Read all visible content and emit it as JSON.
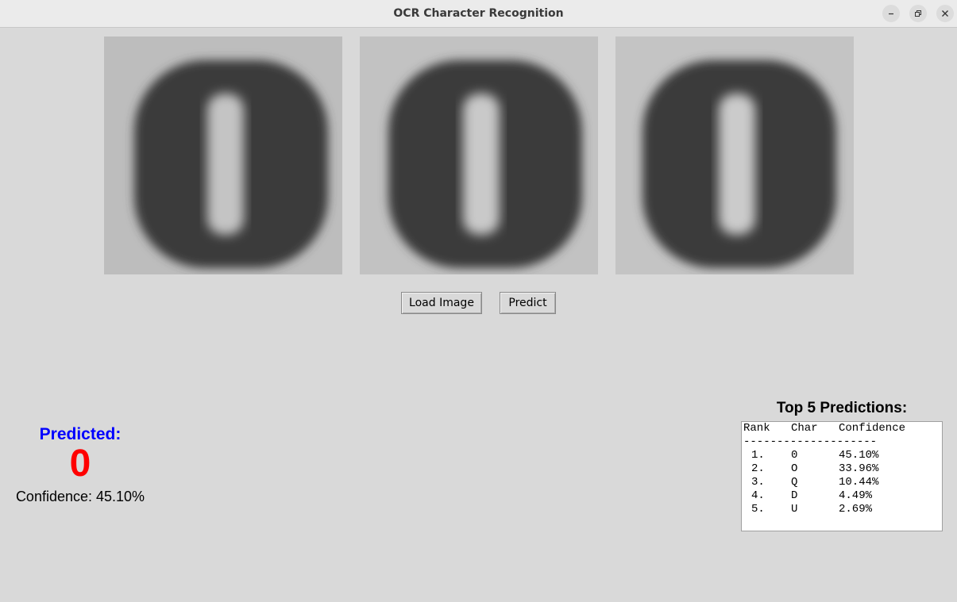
{
  "window": {
    "title": "OCR Character Recognition"
  },
  "images": [
    {
      "alt": "processed image 1"
    },
    {
      "alt": "processed image 2"
    },
    {
      "alt": "processed image 3"
    }
  ],
  "buttons": {
    "load_image": "Load Image",
    "predict": "Predict"
  },
  "result": {
    "label": "Predicted:",
    "character": "0",
    "confidence_text": "Confidence: 45.10%",
    "label_color": "#0000ff",
    "character_color": "#ff0000"
  },
  "top5": {
    "title": "Top 5 Predictions:",
    "headers": {
      "rank": "Rank",
      "char": "Char",
      "confidence": "Confidence"
    },
    "separator": "--------------------",
    "rows": [
      {
        "rank": "1.",
        "char": "0",
        "confidence": "45.10%"
      },
      {
        "rank": "2.",
        "char": "O",
        "confidence": "33.96%"
      },
      {
        "rank": "3.",
        "char": "Q",
        "confidence": "10.44%"
      },
      {
        "rank": "4.",
        "char": "D",
        "confidence": "4.49%"
      },
      {
        "rank": "5.",
        "char": "U",
        "confidence": "2.69%"
      }
    ]
  }
}
